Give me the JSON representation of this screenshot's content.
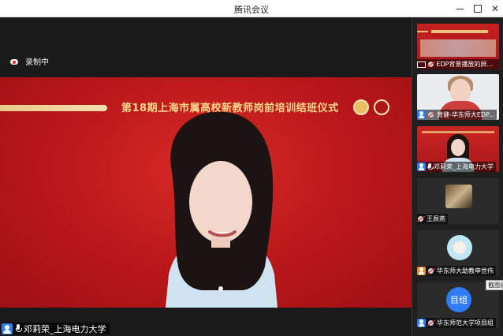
{
  "window": {
    "title": "腾讯会议"
  },
  "recording": {
    "label": "录制中"
  },
  "stage": {
    "banner_title": "第18期上海市属高校新教师岗前培训结班仪式"
  },
  "main_speaker": {
    "name": "邓莉荣_上海电力大学"
  },
  "participants": [
    {
      "name": "EDP背景播放的屏幕...",
      "kind": "screen-share"
    },
    {
      "name": "黄健-华东师大EDP...",
      "kind": "video"
    },
    {
      "name": "邓莉荣_上海电力大学",
      "kind": "video"
    },
    {
      "name": "王辰燕",
      "kind": "camera-off"
    },
    {
      "name": "华东师大助教申世伟",
      "kind": "camera-off"
    },
    {
      "name": "华东师范大学项目组",
      "kind": "camera-off",
      "avatar_text": "目组"
    }
  ],
  "tooltip": {
    "text": "截图("
  },
  "colors": {
    "accent": "#2f7cf6",
    "stage_red": "#c01c1e",
    "title_gold": "#f7d98c"
  }
}
